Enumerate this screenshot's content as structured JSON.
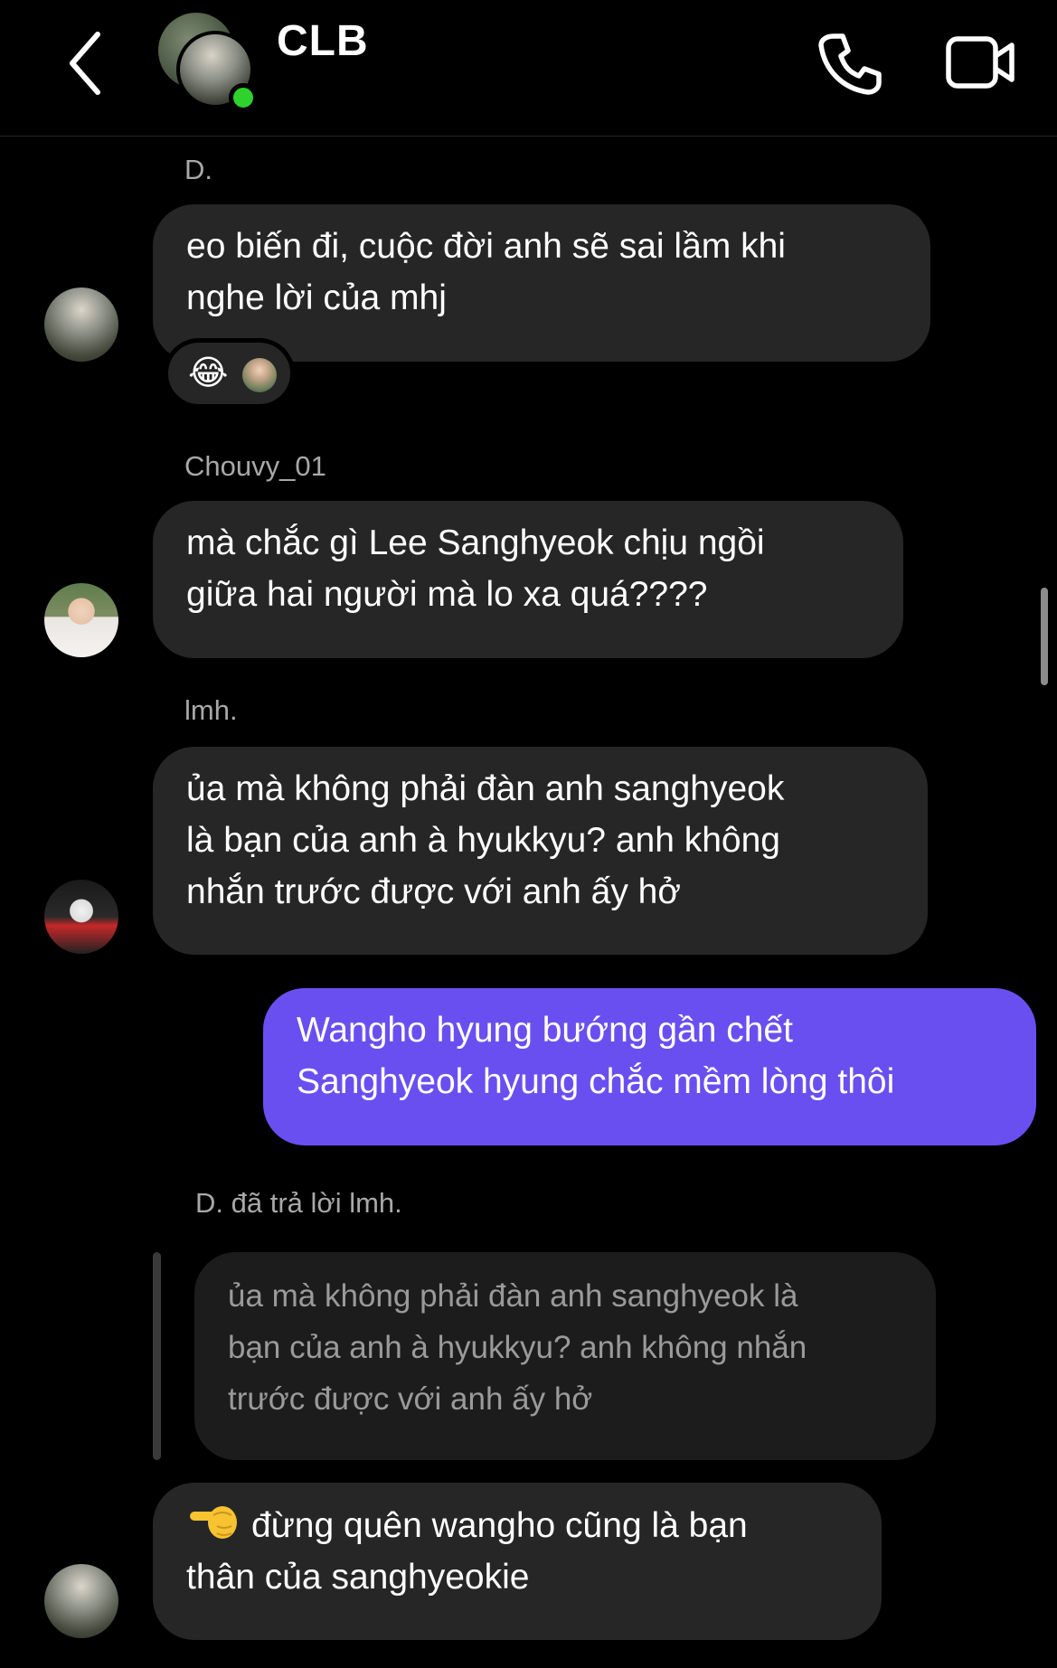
{
  "header": {
    "title": "CLB",
    "back_icon": "chevron-left-icon",
    "call_icon": "phone-icon",
    "video_icon": "video-camera-icon",
    "online_color": "#2fd12c"
  },
  "colors": {
    "background": "#000000",
    "incoming_bubble": "#262626",
    "outgoing_bubble": "#6a4ff0",
    "secondary_text": "#a8a8a8"
  },
  "messages": [
    {
      "sender": "D.",
      "lines": [
        "eo biến đi, cuộc đời anh sẽ sai lầm khi",
        "nghe lời của mhj"
      ],
      "reaction_emoji": "😂"
    },
    {
      "sender": "Chouvy_01",
      "lines": [
        "mà chắc gì Lee Sanghyeok chịu ngồi",
        "giữa hai người mà lo xa quá????"
      ]
    },
    {
      "sender": "lmh.",
      "lines": [
        "ủa mà không phải đàn anh sanghyeok",
        "là bạn của anh à hyukkyu? anh không",
        "nhắn trước được với anh ấy hở"
      ]
    },
    {
      "sender": "me",
      "lines": [
        "Wangho hyung bướng gần chết",
        "Sanghyeok hyung chắc mềm lòng thôi"
      ]
    },
    {
      "reply_label": "D. đã trả lời lmh.",
      "quoted_lines": [
        "ủa mà không phải đàn anh sanghyeok là",
        "bạn của anh à hyukkyu? anh không nhắn",
        "trước được với anh ấy hở"
      ],
      "emoji_icon": "pointing-hand-icon",
      "lines": [
        "đừng quên wangho cũng là bạn",
        "thân của sanghyeokie"
      ]
    }
  ]
}
